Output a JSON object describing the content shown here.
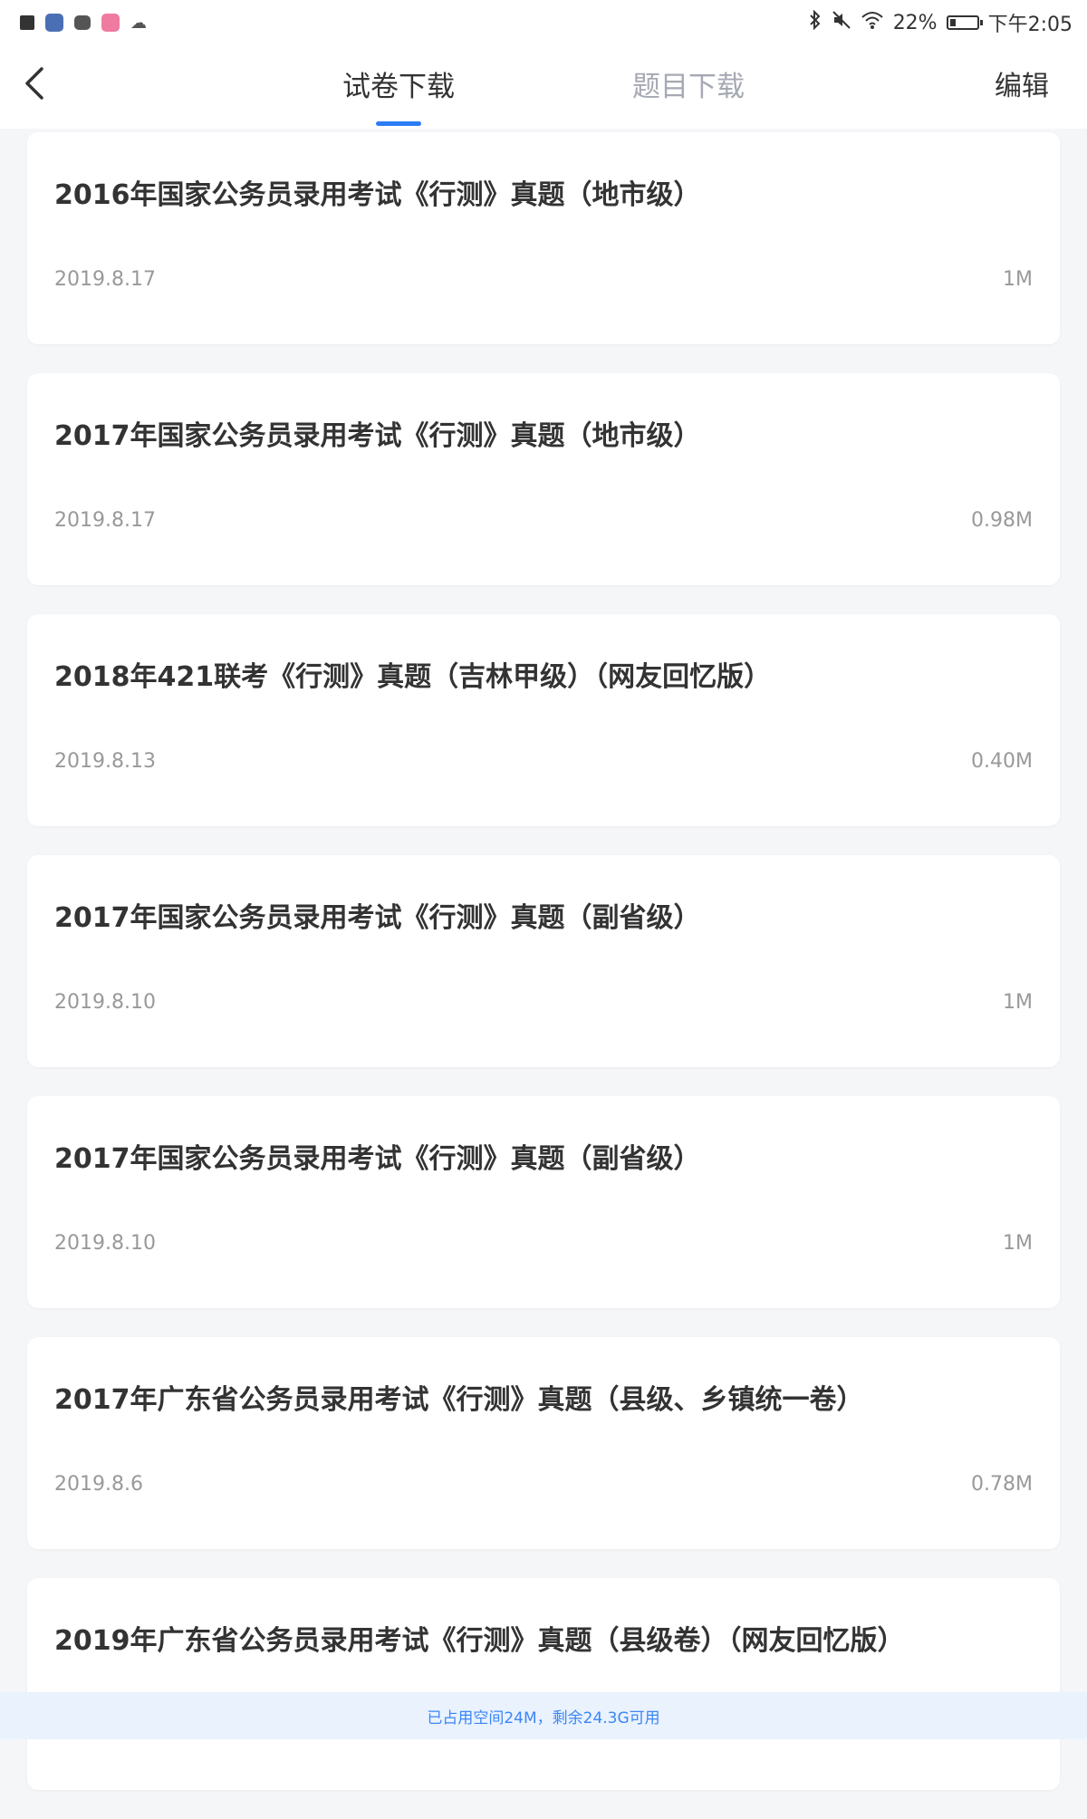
{
  "status_bar": {
    "battery_pct": "22%",
    "battery_level": 0.22,
    "time": "下午2:05",
    "icons": [
      "a-icon",
      "app-icon",
      "book-icon",
      "lala-icon",
      "cloud-icon",
      "bluetooth-icon",
      "mute-icon",
      "wifi-icon",
      "battery-icon"
    ]
  },
  "nav": {
    "tab_paper": "试卷下载",
    "tab_question": "题目下载",
    "edit": "编辑",
    "accent": "#2d7cf6"
  },
  "items": [
    {
      "title": "2016年国家公务员录用考试《行测》真题（地市级）",
      "date": "2019.8.17",
      "size": "1M"
    },
    {
      "title": "2017年国家公务员录用考试《行测》真题（地市级）",
      "date": "2019.8.17",
      "size": "0.98M"
    },
    {
      "title": "2018年421联考《行测》真题（吉林甲级）（网友回忆版）",
      "date": "2019.8.13",
      "size": "0.40M"
    },
    {
      "title": "2017年国家公务员录用考试《行测》真题（副省级）",
      "date": "2019.8.10",
      "size": "1M"
    },
    {
      "title": "2017年国家公务员录用考试《行测》真题（副省级）",
      "date": "2019.8.10",
      "size": "1M"
    },
    {
      "title": "2017年广东省公务员录用考试《行测》真题（县级、乡镇统一卷）",
      "date": "2019.8.6",
      "size": "0.78M"
    },
    {
      "title": "2019年广东省公务员录用考试《行测》真题（县级卷）（网友回忆版）",
      "date": "",
      "size": ""
    }
  ],
  "footer": {
    "storage_text": "已占用空间24M，剩余24.3G可用"
  }
}
